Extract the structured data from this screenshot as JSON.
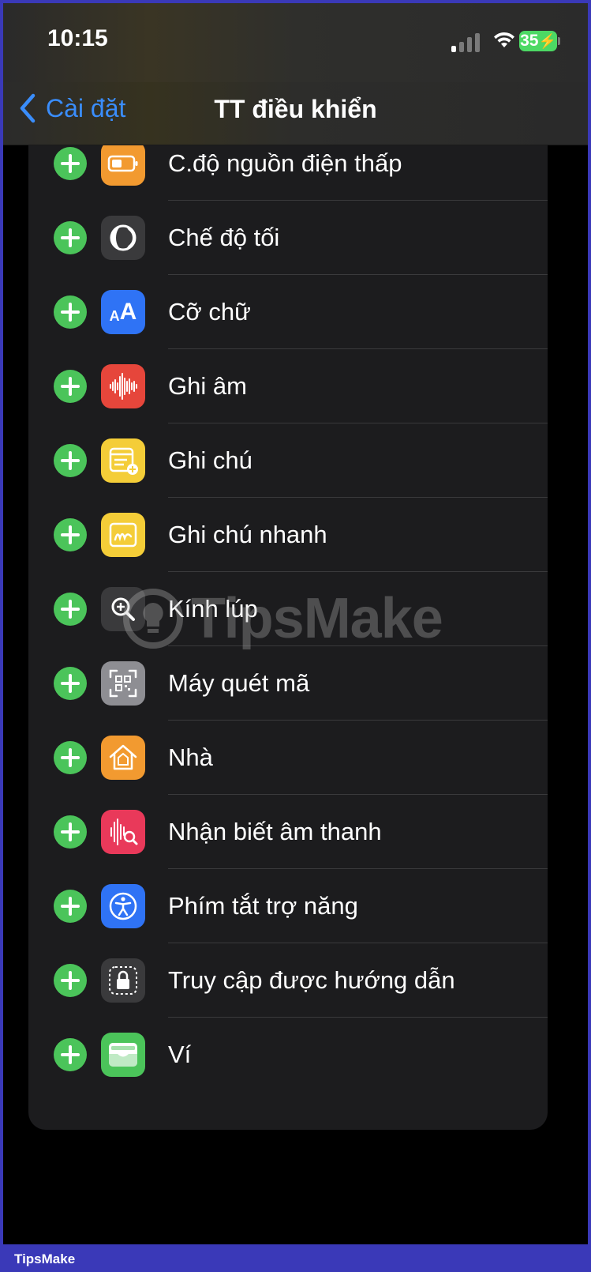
{
  "status_bar": {
    "time": "10:15",
    "battery": "35"
  },
  "nav": {
    "back_label": "Cài đặt",
    "title": "TT điều khiển"
  },
  "items": [
    {
      "label": "",
      "icon": "unknown-orange-icon",
      "color": "#f29a30"
    },
    {
      "label": "C.độ nguồn điện thấp",
      "icon": "low-power-battery-icon",
      "color": "#f29a30"
    },
    {
      "label": "Chế độ tối",
      "icon": "dark-mode-icon",
      "color": "#3a3a3c"
    },
    {
      "label": "Cỡ chữ",
      "icon": "text-size-icon",
      "color": "#2f73f5"
    },
    {
      "label": "Ghi âm",
      "icon": "voice-memos-icon",
      "color": "#e6463b"
    },
    {
      "label": "Ghi chú",
      "icon": "notes-icon",
      "color": "#f4cd38"
    },
    {
      "label": "Ghi chú nhanh",
      "icon": "quick-note-icon",
      "color": "#f4cd38"
    },
    {
      "label": "Kính lúp",
      "icon": "magnifier-icon",
      "color": "#3a3a3c"
    },
    {
      "label": "Máy quét mã",
      "icon": "code-scanner-icon",
      "color": "#8e8e93"
    },
    {
      "label": "Nhà",
      "icon": "home-icon",
      "color": "#f29a30"
    },
    {
      "label": "Nhận biết âm thanh",
      "icon": "sound-recognition-icon",
      "color": "#e9395a"
    },
    {
      "label": "Phím tắt trợ năng",
      "icon": "accessibility-icon",
      "color": "#2f73f5"
    },
    {
      "label": "Truy cập được hướng dẫn",
      "icon": "guided-access-icon",
      "color": "#3a3a3c"
    },
    {
      "label": "Ví",
      "icon": "wallet-icon",
      "color": "#4bc45a"
    }
  ],
  "watermark": "TipsMake",
  "footer": {
    "brand": "TipsMake"
  }
}
